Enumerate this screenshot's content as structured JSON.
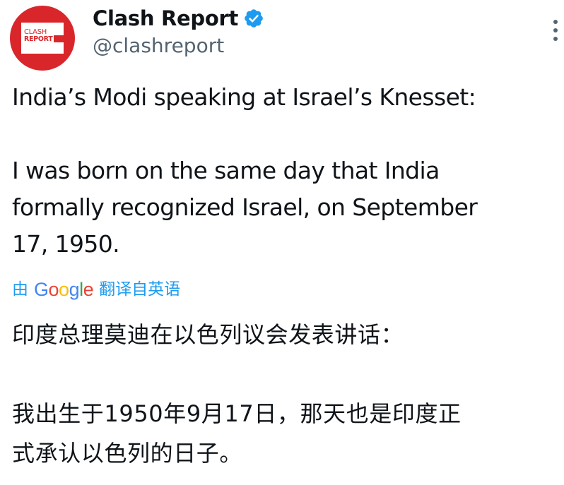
{
  "author": {
    "display_name": "Clash Report",
    "handle": "@clashreport",
    "avatar_text_line1": "CLASH",
    "avatar_text_line2": "REPORT",
    "verified": true
  },
  "tweet": {
    "line1": "India’s Modi speaking at Israel’s Knesset:",
    "para2": [
      "I was born on the same day that India",
      "formally recognized Israel, on September",
      "17, 1950."
    ]
  },
  "translation": {
    "prefix": "由",
    "provider": "Google",
    "suffix": "翻译自英语",
    "line1": "印度总理莫迪在以色列议会发表讲话：",
    "para2": [
      "我出生于1950年9月17日，那天也是印度正",
      "式承认以色列的日子。"
    ]
  },
  "icons": {
    "verified": "verified-badge-icon",
    "more": "more-options-icon"
  },
  "colors": {
    "brand_red": "#d9262b",
    "text": "#0f1419",
    "secondary": "#536471",
    "link": "#1d9bf0",
    "verified": "#1d9bf0",
    "google_blue": "#4285f4",
    "google_red": "#ea4335",
    "google_yellow": "#fbbc05",
    "google_green": "#34a853"
  }
}
